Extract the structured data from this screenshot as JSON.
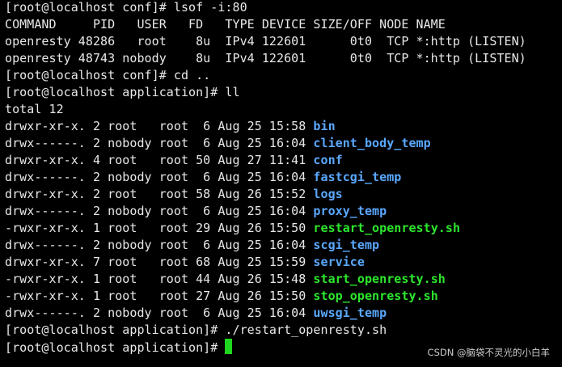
{
  "colors": {
    "background": "#000000",
    "text": "#e8e8e8",
    "directory": "#5aa8ff",
    "executable": "#2de62d",
    "cursor": "#1ed71e"
  },
  "lines": [
    "[root@localhost conf]# lsof -i:80",
    "COMMAND     PID   USER   FD   TYPE DEVICE SIZE/OFF NODE NAME",
    "openresty 48286   root    8u  IPv4 122601      0t0  TCP *:http (LISTEN)",
    "openresty 48743 nobody    8u  IPv4 122601      0t0  TCP *:http (LISTEN)",
    "[root@localhost conf]# cd ..",
    "[root@localhost application]# ll",
    "total 12"
  ],
  "listing": [
    {
      "perms": "drwxr-xr-x. 2 root   root  6 Aug 25 15:58 ",
      "name": "bin",
      "kind": "dir"
    },
    {
      "perms": "drwx------. 2 nobody root  6 Aug 25 16:04 ",
      "name": "client_body_temp",
      "kind": "dir"
    },
    {
      "perms": "drwxr-xr-x. 4 root   root 50 Aug 27 11:41 ",
      "name": "conf",
      "kind": "dir"
    },
    {
      "perms": "drwx------. 2 nobody root  6 Aug 25 16:04 ",
      "name": "fastcgi_temp",
      "kind": "dir"
    },
    {
      "perms": "drwxr-xr-x. 2 root   root 58 Aug 26 15:52 ",
      "name": "logs",
      "kind": "dir"
    },
    {
      "perms": "drwx------. 2 nobody root  6 Aug 25 16:04 ",
      "name": "proxy_temp",
      "kind": "dir"
    },
    {
      "perms": "-rwxr-xr-x. 1 root   root 29 Aug 26 15:50 ",
      "name": "restart_openresty.sh",
      "kind": "exe"
    },
    {
      "perms": "drwx------. 2 nobody root  6 Aug 25 16:04 ",
      "name": "scgi_temp",
      "kind": "dir"
    },
    {
      "perms": "drwxr-xr-x. 7 root   root 68 Aug 25 15:59 ",
      "name": "service",
      "kind": "dir"
    },
    {
      "perms": "-rwxr-xr-x. 1 root   root 44 Aug 26 15:48 ",
      "name": "start_openresty.sh",
      "kind": "exe"
    },
    {
      "perms": "-rwxr-xr-x. 1 root   root 27 Aug 26 15:50 ",
      "name": "stop_openresty.sh",
      "kind": "exe"
    },
    {
      "perms": "drwx------. 2 nobody root  6 Aug 25 16:04 ",
      "name": "uwsgi_temp",
      "kind": "dir"
    }
  ],
  "after_lines": [
    "[root@localhost application]# ./restart_openresty.sh"
  ],
  "prompt_line": "[root@localhost application]# ",
  "watermark": "CSDN @脑袋不灵光的小白羊"
}
